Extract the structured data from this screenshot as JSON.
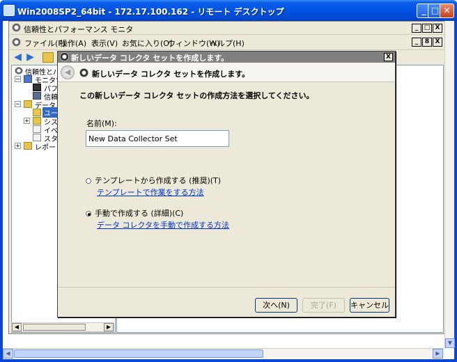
{
  "outer_window": {
    "title": "Win2008SP2_64bit - 172.17.100.162 - リモート デスクトップ",
    "buttons": [
      "_",
      "□",
      "✕"
    ]
  },
  "mmc": {
    "title": "信頼性とパフォーマンス モニタ",
    "title_buttons": [
      "_",
      "□",
      "X"
    ],
    "menu": [
      "ファイル(F)",
      "操作(A)",
      "表示(V)",
      "お気に入り(O)",
      "ウィンドウ(W)",
      "ヘルプ(H)"
    ],
    "menu_buttons": [
      "_",
      "8",
      "X"
    ],
    "tree": [
      {
        "label": "信頼性とパフ",
        "level": 0,
        "toggle": ""
      },
      {
        "label": "モニタツ",
        "level": 1,
        "toggle": "⊟"
      },
      {
        "label": "パフ",
        "level": 2,
        "toggle": ""
      },
      {
        "label": "信頼",
        "level": 2,
        "toggle": ""
      },
      {
        "label": "データコ",
        "level": 1,
        "toggle": "⊟"
      },
      {
        "label": "ユー",
        "level": 2,
        "toggle": ""
      },
      {
        "label": "シス",
        "level": 2,
        "toggle": "⊞"
      },
      {
        "label": "イベ",
        "level": 2,
        "toggle": ""
      },
      {
        "label": "スタ",
        "level": 2,
        "toggle": ""
      },
      {
        "label": "レポート",
        "level": 1,
        "toggle": "⊞"
      }
    ]
  },
  "dialog": {
    "title": "新しいデータ コレクタ セットを作成します。",
    "close": "X",
    "header_text": "新しいデータ コレクタ セットを作成します。",
    "prompt": "この新しいデータ コレクタ セットの作成方法を選択してください。",
    "name_label": "名前(M):",
    "name_value": "New Data Collector Set",
    "option_template": "テンプレートから作成する (推奨)(T)",
    "link_template": "テンプレートで作業をする方法",
    "option_manual": "手動で作成する (詳細)(C)",
    "link_manual": "データ コレクタを手動で作成する方法",
    "selected_option": "manual",
    "btn_next": "次へ(N)",
    "btn_finish": "完了(F)",
    "btn_cancel": "キャンセル"
  }
}
